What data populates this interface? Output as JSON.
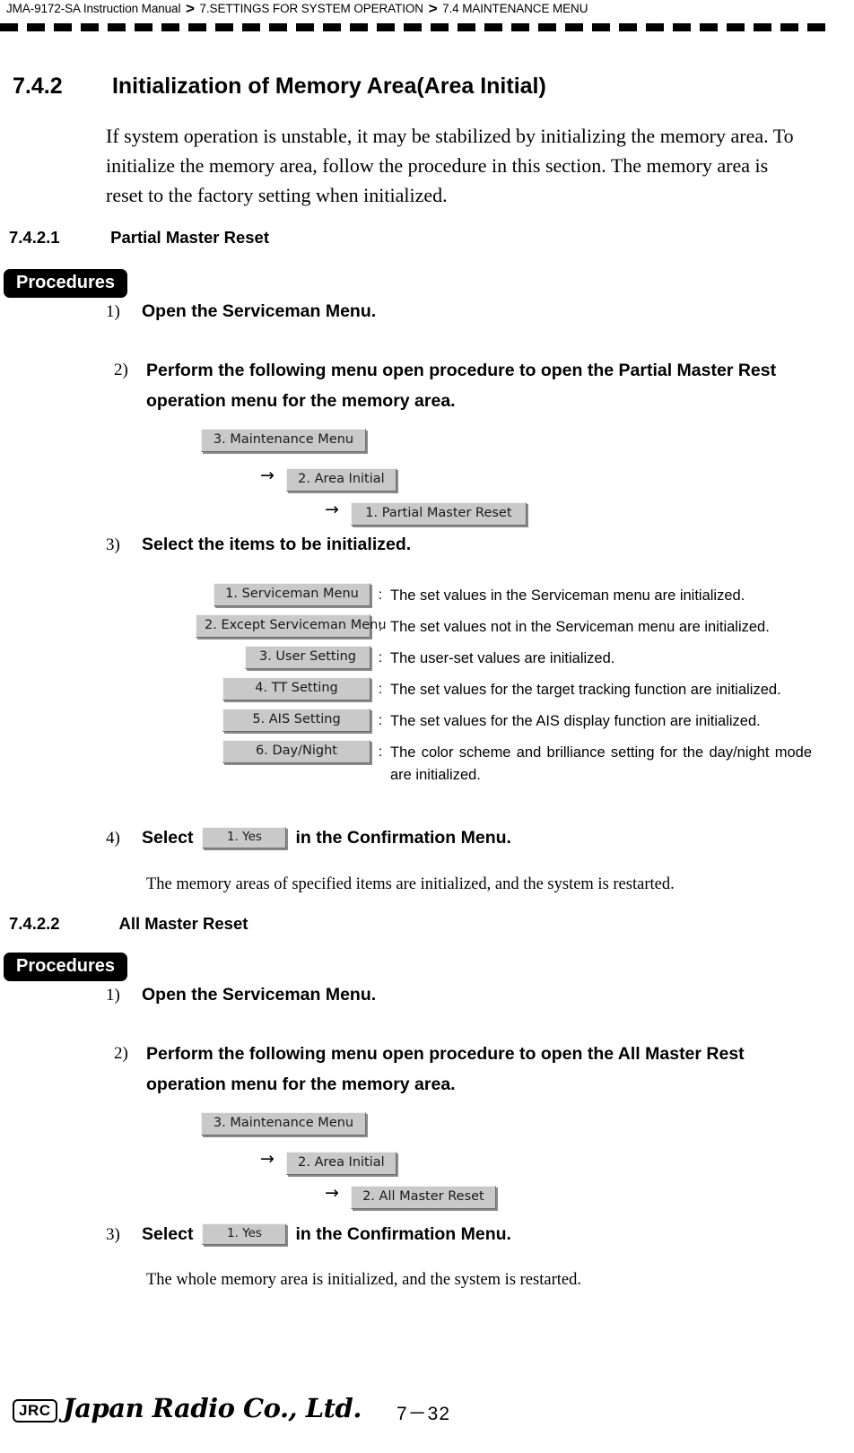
{
  "header": {
    "manual": "JMA-9172-SA Instruction Manual",
    "separator": ">",
    "chapter": "7.SETTINGS FOR SYSTEM OPERATION",
    "section": "7.4  MAINTENANCE MENU"
  },
  "section_742": {
    "number": "7.4.2",
    "title": "Initialization of Memory Area(Area Initial)",
    "intro": "If system operation is unstable, it may be stabilized by initializing the memory area. To initialize the memory area, follow the procedure in this section. The memory area is reset to the factory setting when initialized."
  },
  "section_7421": {
    "number": "7.4.2.1",
    "title": "Partial Master Reset",
    "procedures_label": "Procedures",
    "step1": {
      "marker": "1)",
      "text": "Open the Serviceman Menu."
    },
    "step2": {
      "marker": "2)",
      "text": "Perform the following menu open procedure to open the Partial Master Rest operation menu for the memory area."
    },
    "menu_chain": [
      "3. Maintenance Menu",
      "2. Area Initial",
      "1. Partial Master Reset"
    ],
    "arrow": "→",
    "step3": {
      "marker": "3)",
      "text": "Select the items to be initialized."
    },
    "items": [
      {
        "key": "1. Serviceman Menu",
        "colon": ":",
        "desc": "The set values in the Serviceman menu are initialized."
      },
      {
        "key": "2. Except Serviceman Menu",
        "colon": ":",
        "desc": "The set values not in the Serviceman menu are initialized."
      },
      {
        "key": "3. User Setting",
        "colon": ":",
        "desc": "The user-set values are initialized."
      },
      {
        "key": "4. TT Setting",
        "colon": ":",
        "desc": "The set values for the target tracking function are initialized."
      },
      {
        "key": "5. AIS Setting",
        "colon": ":",
        "desc": "The set values for the AIS display function are initialized."
      },
      {
        "key": "6. Day/Night",
        "colon": ":",
        "desc": "The color scheme and brilliance setting for the day/night mode are initialized."
      }
    ],
    "step4": {
      "marker": "4)",
      "text_before": "Select",
      "key": "1. Yes",
      "text_after": "in the Confirmation Menu."
    },
    "result": "The memory areas of specified items are initialized, and the system is restarted."
  },
  "section_7422": {
    "number": "7.4.2.2",
    "title": "All Master Reset",
    "procedures_label": "Procedures",
    "step1": {
      "marker": "1)",
      "text": "Open the Serviceman Menu."
    },
    "step2": {
      "marker": "2)",
      "text": "Perform the following menu open procedure to open the All Master Rest operation menu for the memory area."
    },
    "menu_chain": [
      "3. Maintenance Menu",
      "2. Area Initial",
      "2. All Master Reset"
    ],
    "arrow": "→",
    "step3": {
      "marker": "3)",
      "text_before": "Select",
      "key": "1. Yes",
      "text_after": "in the Confirmation Menu."
    },
    "result": "The whole memory area is initialized, and the system is restarted."
  },
  "footer": {
    "logo_mark": "JRC",
    "company": "Japan Radio Co., Ltd.",
    "page_number": "7－32"
  }
}
